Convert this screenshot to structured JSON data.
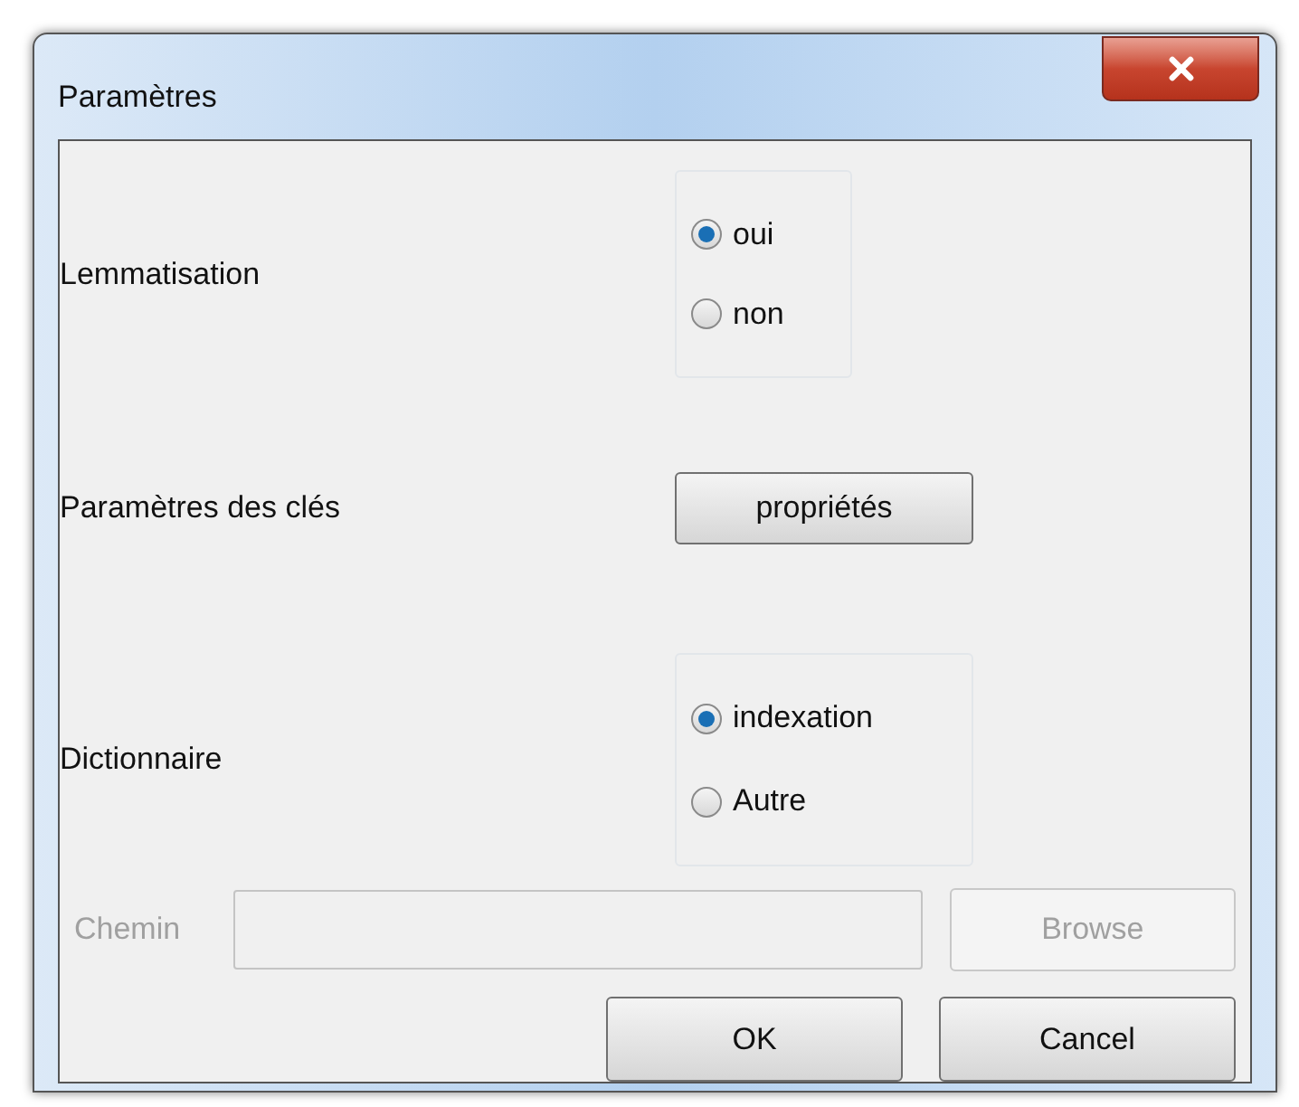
{
  "window": {
    "title": "Paramètres"
  },
  "lemmatisation": {
    "label": "Lemmatisation",
    "options": [
      {
        "label": "oui",
        "selected": true
      },
      {
        "label": "non",
        "selected": false
      }
    ]
  },
  "keys": {
    "label": "Paramètres des clés",
    "button": "propriétés"
  },
  "dictionary": {
    "label": "Dictionnaire",
    "options": [
      {
        "label": "indexation",
        "selected": true
      },
      {
        "label": "Autre",
        "selected": false
      }
    ]
  },
  "path": {
    "label": "Chemin",
    "disabled": true,
    "browse": "Browse"
  },
  "buttons": [
    "OK",
    "Cancel"
  ]
}
